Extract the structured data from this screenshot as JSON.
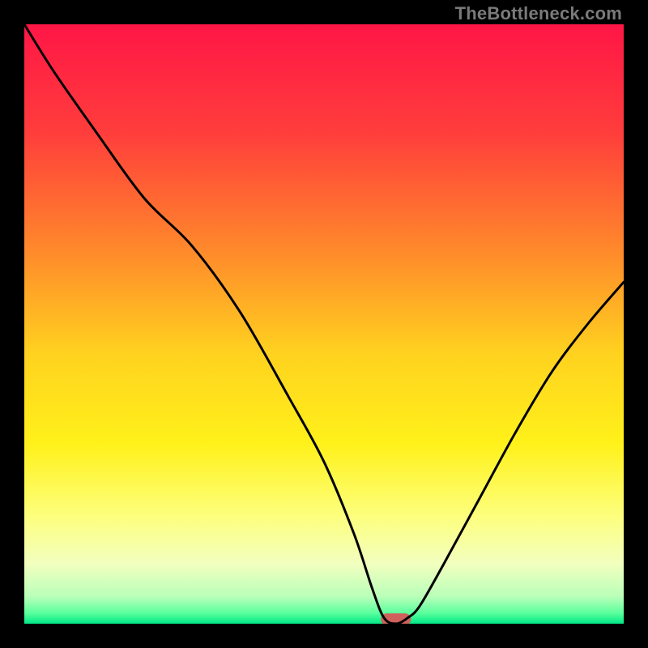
{
  "watermark": "TheBottleneck.com",
  "chart_data": {
    "type": "line",
    "title": "",
    "xlabel": "",
    "ylabel": "",
    "xlim": [
      0,
      100
    ],
    "ylim": [
      0,
      100
    ],
    "grid": false,
    "legend": false,
    "gradient_stops": [
      {
        "pos": 0.0,
        "color": "#ff1646"
      },
      {
        "pos": 0.18,
        "color": "#ff3d3c"
      },
      {
        "pos": 0.38,
        "color": "#ff8a2b"
      },
      {
        "pos": 0.55,
        "color": "#ffd21f"
      },
      {
        "pos": 0.7,
        "color": "#fff11a"
      },
      {
        "pos": 0.82,
        "color": "#fdff7d"
      },
      {
        "pos": 0.9,
        "color": "#f2ffbf"
      },
      {
        "pos": 0.955,
        "color": "#b9ffb9"
      },
      {
        "pos": 0.982,
        "color": "#5cff9d"
      },
      {
        "pos": 1.0,
        "color": "#00e886"
      }
    ],
    "series": [
      {
        "name": "bottleneck-curve",
        "x": [
          0,
          5,
          12,
          20,
          28,
          36,
          44,
          50,
          55,
          58,
          60,
          62,
          64,
          66,
          70,
          76,
          82,
          88,
          94,
          100
        ],
        "y": [
          100,
          92,
          82,
          71,
          63,
          52,
          38,
          27,
          15,
          6,
          1,
          0,
          1,
          3,
          10,
          21,
          32,
          42,
          50,
          57
        ]
      }
    ],
    "marker": {
      "name": "optimal-marker",
      "x": 62,
      "y": 0,
      "color": "#d0605b",
      "width_units": 5,
      "height_units": 2
    }
  }
}
